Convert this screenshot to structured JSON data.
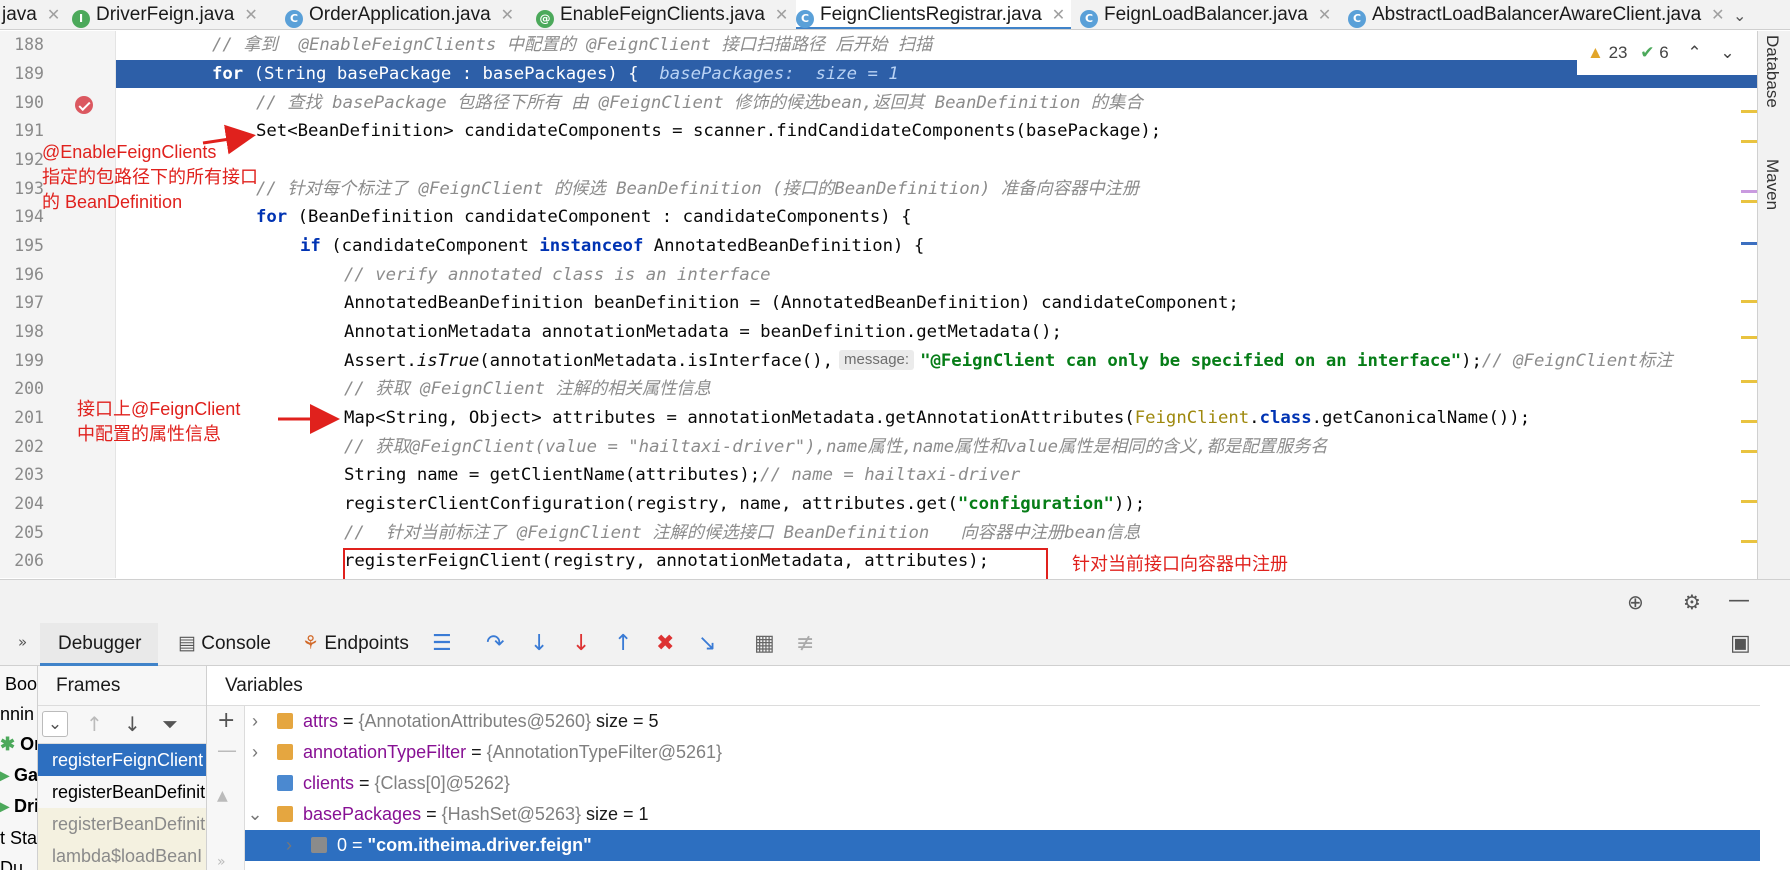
{
  "tabs": [
    {
      "label": "java",
      "icon": "none",
      "active": false
    },
    {
      "label": "DriverFeign.java",
      "icon": "interface-icon",
      "active": false
    },
    {
      "label": "OrderApplication.java",
      "icon": "class-icon",
      "active": false
    },
    {
      "label": "EnableFeignClients.java",
      "icon": "annotation-icon",
      "active": false
    },
    {
      "label": "FeignClientsRegistrar.java",
      "icon": "class-icon",
      "active": true
    },
    {
      "label": "FeignLoadBalancer.java",
      "icon": "class-icon",
      "active": false
    },
    {
      "label": "AbstractLoadBalancerAwareClient.java",
      "icon": "class-icon",
      "active": false
    }
  ],
  "line_numbers": [
    "188",
    "189",
    "190",
    "191",
    "192",
    "193",
    "194",
    "195",
    "196",
    "197",
    "198",
    "199",
    "200",
    "201",
    "202",
    "203",
    "204",
    "205",
    "206"
  ],
  "inspection": {
    "warnings": "23",
    "ok": "6"
  },
  "right_panels": [
    "Database",
    "Maven"
  ],
  "code": {
    "l188": "// 拿到  @EnableFeignClients 中配置的 @FeignClient 接口扫描路径 后开始 扫描",
    "l189_a": "for",
    "l189_b": " (String basePackage : basePackages) {  ",
    "l189_hint": "basePackages:  size = 1",
    "l190": "// 查找 basePackage 包路径下所有 由 @FeignClient 修饰的候选bean,返回其 BeanDefinition 的集合",
    "l191": "Set<BeanDefinition> candidateComponents = scanner.findCandidateComponents(basePackage);",
    "l193": "// 针对每个标注了 @FeignClient 的候选 BeanDefinition (接口的BeanDefinition) 准备向容器中注册",
    "l194_a": "for",
    "l194_b": " (BeanDefinition candidateComponent : candidateComponents) {",
    "l195_a": "if",
    "l195_b": " (candidateComponent ",
    "l195_c": "instanceof",
    "l195_d": " AnnotatedBeanDefinition) {",
    "l196": "// verify annotated class is an interface",
    "l197": "AnnotatedBeanDefinition beanDefinition = (AnnotatedBeanDefinition) candidateComponent;",
    "l198": "AnnotationMetadata annotationMetadata = beanDefinition.getMetadata();",
    "l199_a": "Assert.",
    "l199_b": "isTrue",
    "l199_c": "(annotationMetadata.isInterface(),",
    "l199_hint": "message:",
    "l199_str": "\"@FeignClient can only be specified on an interface\"",
    "l199_d": ");",
    "l199_cm": "// @FeignClient标注",
    "l200": "// 获取 @FeignClient 注解的相关属性信息",
    "l201_a": "Map<String, Object> attributes = annotationMetadata.getAnnotationAttributes(",
    "l201_b": "FeignClient",
    "l201_c": ".",
    "l201_d": "class",
    "l201_e": ".getCanonicalName());",
    "l202": "// 获取@FeignClient(value = \"hailtaxi-driver\"),name属性,name属性和value属性是相同的含义,都是配置服务名",
    "l203_a": "String name = getClientName(attributes);",
    "l203_cm": "// name = hailtaxi-driver",
    "l204_a": "registerClientConfiguration(registry, name, attributes.get(",
    "l204_str": "\"configuration\"",
    "l204_b": "));",
    "l205": "//  针对当前标注了 @FeignClient 注解的候选接口 BeanDefinition   向容器中注册bean信息",
    "l206": "registerFeignClient(registry, annotationMetadata, attributes);"
  },
  "annotations": {
    "a1": [
      "@EnableFeignClients",
      "指定的包路径下的所有接口",
      "的 BeanDefinition"
    ],
    "a2": [
      "接口上@FeignClient",
      "中配置的属性信息"
    ],
    "a3": "针对当前接口向容器中注册"
  },
  "debugger_tabs": [
    "Debugger",
    "Console",
    "Endpoints"
  ],
  "left_strip": [
    "g Boo",
    "unnin",
    "Ord",
    "Ga",
    "Dri",
    "ot Sta",
    "Du"
  ],
  "frames_header": "Frames",
  "frames": [
    {
      "label": "registerFeignClient",
      "state": "selected"
    },
    {
      "label": "registerBeanDefinit",
      "state": "normal"
    },
    {
      "label": "registerBeanDefinit",
      "state": "dim"
    },
    {
      "label": "lambda$loadBeanI",
      "state": "dim"
    }
  ],
  "variables_header": "Variables",
  "variables": [
    {
      "name": "attrs",
      "value": "{AnnotationAttributes@5260}",
      "extra": "size = 5",
      "expand": ">"
    },
    {
      "name": "annotationTypeFilter",
      "value": "{AnnotationTypeFilter@5261}",
      "extra": "",
      "expand": ">"
    },
    {
      "name": "clients",
      "value": "{Class[0]@5262}",
      "extra": "",
      "expand": ""
    },
    {
      "name": "basePackages",
      "value": "{HashSet@5263}",
      "extra": "size = 1",
      "expand": "v"
    },
    {
      "name": "0",
      "value": "\"com.itheima.driver.feign\"",
      "extra": "",
      "expand": ">"
    }
  ],
  "colors": {
    "accent": "#2d6fc0",
    "annotation_red": "#e0211d",
    "exec_line": "#2d5fa8"
  }
}
